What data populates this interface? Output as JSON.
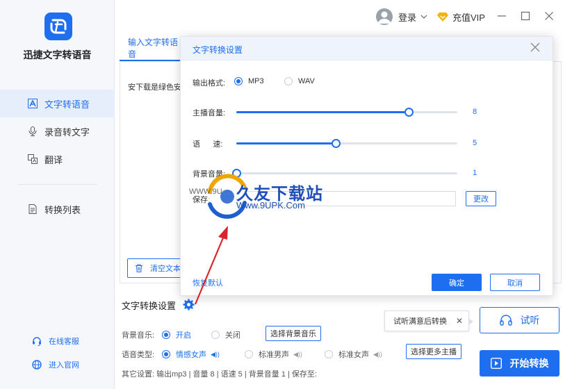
{
  "app": {
    "name": "迅捷文字转语音"
  },
  "sidebar": {
    "items": [
      {
        "label": "文字转语音",
        "icon": "text-to-speech-icon",
        "active": true
      },
      {
        "label": "录音转文字",
        "icon": "microphone-icon",
        "active": false
      },
      {
        "label": "翻译",
        "icon": "translate-icon",
        "active": false
      },
      {
        "label": "转换列表",
        "icon": "list-icon",
        "active": false
      }
    ],
    "bottom_links": [
      {
        "label": "在线客服",
        "icon": "headset-icon"
      },
      {
        "label": "进入官网",
        "icon": "globe-icon"
      }
    ]
  },
  "topbar": {
    "login": "登录",
    "vip": "充值VIP"
  },
  "main": {
    "tab_label": "输入文字转语音",
    "text_preview": "安下载是绿色安",
    "clear_button": "清空文本",
    "settings_title": "文字转换设置",
    "bg_music_label": "背景音乐:",
    "bg_music_on": "开启",
    "bg_music_off": "关闭",
    "bg_music_button": "选择背景音乐",
    "voice_type_label": "语音类型:",
    "voice_emotional_female": "情感女声",
    "voice_standard_male": "标准男声",
    "voice_standard_female": "标准女声",
    "more_voices_button": "选择更多主播",
    "other_settings": "其它设置:    输出mp3  |  音量 8  |  语速 5  |  背景音量 1  |  保存至:",
    "tip_text": "试听满意后转换",
    "listen_button": "试听",
    "start_button": "开始转换"
  },
  "dialog": {
    "title": "文字转换设置",
    "output_format_label": "输出格式:",
    "format_mp3": "MP3",
    "format_wav": "WAV",
    "selected_format": "MP3",
    "volume_label": "主播音量:",
    "volume_value": "8",
    "volume_fraction": 0.78,
    "speed_label": "语      速:",
    "speed_value": "5",
    "speed_fraction": 0.45,
    "bg_volume_label": "背景音量:",
    "bg_volume_value": "1",
    "bg_volume_fraction": 0.0,
    "save_label": "保存:",
    "change_button": "更改",
    "restore_default": "恢复默认",
    "ok_button": "确定",
    "cancel_button": "取消"
  },
  "watermark": {
    "text": "久友下载站",
    "url": "Www.9UPK.Com",
    "prefix": "WWW.9U"
  },
  "colors": {
    "accent": "#1e6ff0",
    "vip": "#f5b400",
    "sidebar_bg": "#f6f7fb"
  }
}
